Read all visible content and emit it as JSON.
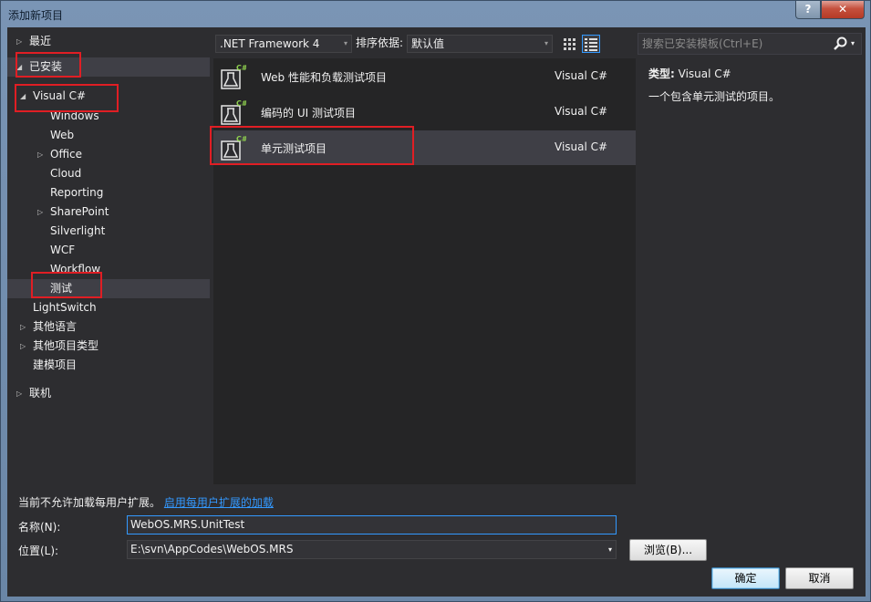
{
  "window": {
    "title": "添加新项目",
    "help_label": "?",
    "close_label": "✕"
  },
  "tree": {
    "items": [
      {
        "label": "最近",
        "expander": "▷"
      },
      {
        "label": "已安装",
        "expander": "◢"
      },
      {
        "label": "Visual C#",
        "expander": "◢"
      },
      {
        "label": "Windows",
        "expander": ""
      },
      {
        "label": "Web",
        "expander": ""
      },
      {
        "label": "Office",
        "expander": "▷"
      },
      {
        "label": "Cloud",
        "expander": ""
      },
      {
        "label": "Reporting",
        "expander": ""
      },
      {
        "label": "SharePoint",
        "expander": "▷"
      },
      {
        "label": "Silverlight",
        "expander": ""
      },
      {
        "label": "WCF",
        "expander": ""
      },
      {
        "label": "Workflow",
        "expander": ""
      },
      {
        "label": "测试",
        "expander": ""
      },
      {
        "label": "LightSwitch",
        "expander": ""
      },
      {
        "label": "其他语言",
        "expander": "▷"
      },
      {
        "label": "其他项目类型",
        "expander": "▷"
      },
      {
        "label": "建模项目",
        "expander": ""
      },
      {
        "label": "联机",
        "expander": "▷"
      }
    ]
  },
  "toolbar": {
    "framework": ".NET Framework 4",
    "sort_label": "排序依据:",
    "sort_value": "默认值",
    "combo_arrow": "▾"
  },
  "templates": [
    {
      "name": "Web 性能和负载测试项目",
      "lang": "Visual C#"
    },
    {
      "name": "编码的 UI 测试项目",
      "lang": "Visual C#"
    },
    {
      "name": "单元测试项目",
      "lang": "Visual C#"
    }
  ],
  "icon_badge": "C#",
  "search": {
    "placeholder": "搜索已安装模板(Ctrl+E)",
    "arrow": "▾"
  },
  "description": {
    "type_label": "类型:",
    "type_value": "Visual C#",
    "text": "一个包含单元测试的项目。"
  },
  "bottom": {
    "notice": "当前不允许加载每用户扩展。",
    "notice_link": "启用每用户扩展的加载",
    "name_label": "名称(N):",
    "name_value": "WebOS.MRS.UnitTest",
    "location_label": "位置(L):",
    "location_value": "E:\\svn\\AppCodes\\WebOS.MRS",
    "location_arrow": "▾",
    "browse_label": "浏览(B)...",
    "ok_label": "确定",
    "cancel_label": "取消"
  },
  "colors": {
    "highlight_box": "#e01e24",
    "accent": "#3399ff",
    "panel": "#2d2d30"
  }
}
